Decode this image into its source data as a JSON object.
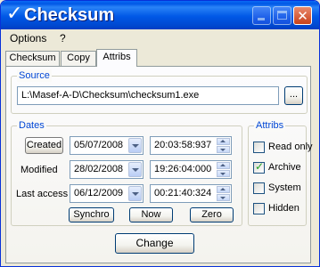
{
  "window": {
    "title": "Checksum",
    "title_icon": "checkmark-icon",
    "controls": [
      "minimize-icon",
      "maximize-icon",
      "close-icon"
    ]
  },
  "menu": {
    "items": [
      {
        "label": "Options"
      },
      {
        "label": "?"
      }
    ]
  },
  "tabs": [
    {
      "label": "Checksum",
      "active": false
    },
    {
      "label": "Copy",
      "active": false
    },
    {
      "label": "Attribs",
      "active": true
    }
  ],
  "source": {
    "legend": "Source",
    "path": "L:\\Masef-A-D\\Checksum\\checksum1.exe",
    "browse_label": "..."
  },
  "dates": {
    "legend": "Dates",
    "rows": [
      {
        "label": "Created",
        "is_button": true,
        "date": "05/07/2008",
        "time": "20:03:58:937"
      },
      {
        "label": "Modified",
        "is_button": false,
        "date": "28/02/2008",
        "time": "19:26:04:000"
      },
      {
        "label": "Last access",
        "is_button": false,
        "date": "06/12/2009",
        "time": "00:21:40:324"
      }
    ],
    "buttons": {
      "synchro": "Synchro",
      "now": "Now",
      "zero": "Zero"
    }
  },
  "attribs": {
    "legend": "Attribs",
    "items": [
      {
        "label": "Read only",
        "checked": false
      },
      {
        "label": "Archive",
        "checked": true
      },
      {
        "label": "System",
        "checked": false
      },
      {
        "label": "Hidden",
        "checked": false
      }
    ]
  },
  "actions": {
    "change": "Change"
  },
  "colors": {
    "titlebar": "#0058e6",
    "legend_text": "#0046d5",
    "window_bg": "#ece9d8"
  }
}
